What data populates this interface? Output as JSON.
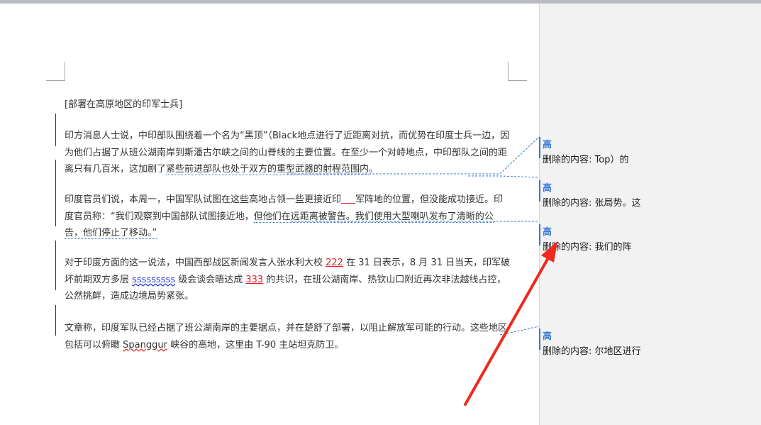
{
  "document": {
    "heading": "[部署在高原地区的印军士兵]",
    "p1": {
      "t1": "印方消息人士说，中印部队围绕着一个名为“黑顶”（Black地点进行了近距离对抗，而优势在印度士兵一边，因为他们占据了从班公湖南岸到斯潘古尔峡之间的山脊线的主要位置。在至少一个对峙地点，中印部队之间的距离只有几百米，这加剧了",
      "t2": "紧些前进部队也处于双方的重型武器的射程范围内",
      "t3": "。"
    },
    "p2": {
      "t1": "印度官员们说，本周一，中国军队试图在这些高地占领一些更接近印",
      "t2": "军阵地的位置，但没能成功接近。印度官员称：“我们观察到中国部队试图接近地，",
      "t3": "但他们在远距离被警告。我们使用大型喇叭发布了清晰的公告，他们停止了移动。”"
    },
    "p3": {
      "t1": "对于印度方面的这一说法，中国西部战区新闻发言人张水利大校 ",
      "ins1": "222",
      "t2": " 在 31 日表示，8 月 31 日当天，印军破坏前期双方多层 ",
      "word": "sssssssss",
      "t3": " 级会谈会晤达成 ",
      "ins2": "333",
      "t4": " 的共识，在班公湖南岸、热钦山口附近再次非法越线占控，公然挑衅，造成边境局势紧张。"
    },
    "p4": {
      "t1": "文章称，印度军队已经占据了班公湖南岸的主要据点，并在楚舒了部署，以阻止解放军可能的行动。这些地区包括可以俯瞰 ",
      "word": "Spanggur",
      "t2": " 峡谷的高地，这里由 T-90 主站坦克防卫。"
    }
  },
  "comments": [
    {
      "level": "高",
      "text": "删除的内容:  Top）的"
    },
    {
      "level": "高",
      "text": "删除的内容: 张局势。这"
    },
    {
      "level": "高",
      "text": "删除的内容: 我们的阵"
    },
    {
      "level": "高",
      "text": "删除的内容: 尔地区进行"
    }
  ],
  "colors": {
    "accent": "#3a7bd5",
    "insertion": "#e02020",
    "arrow": "#f0281e"
  }
}
